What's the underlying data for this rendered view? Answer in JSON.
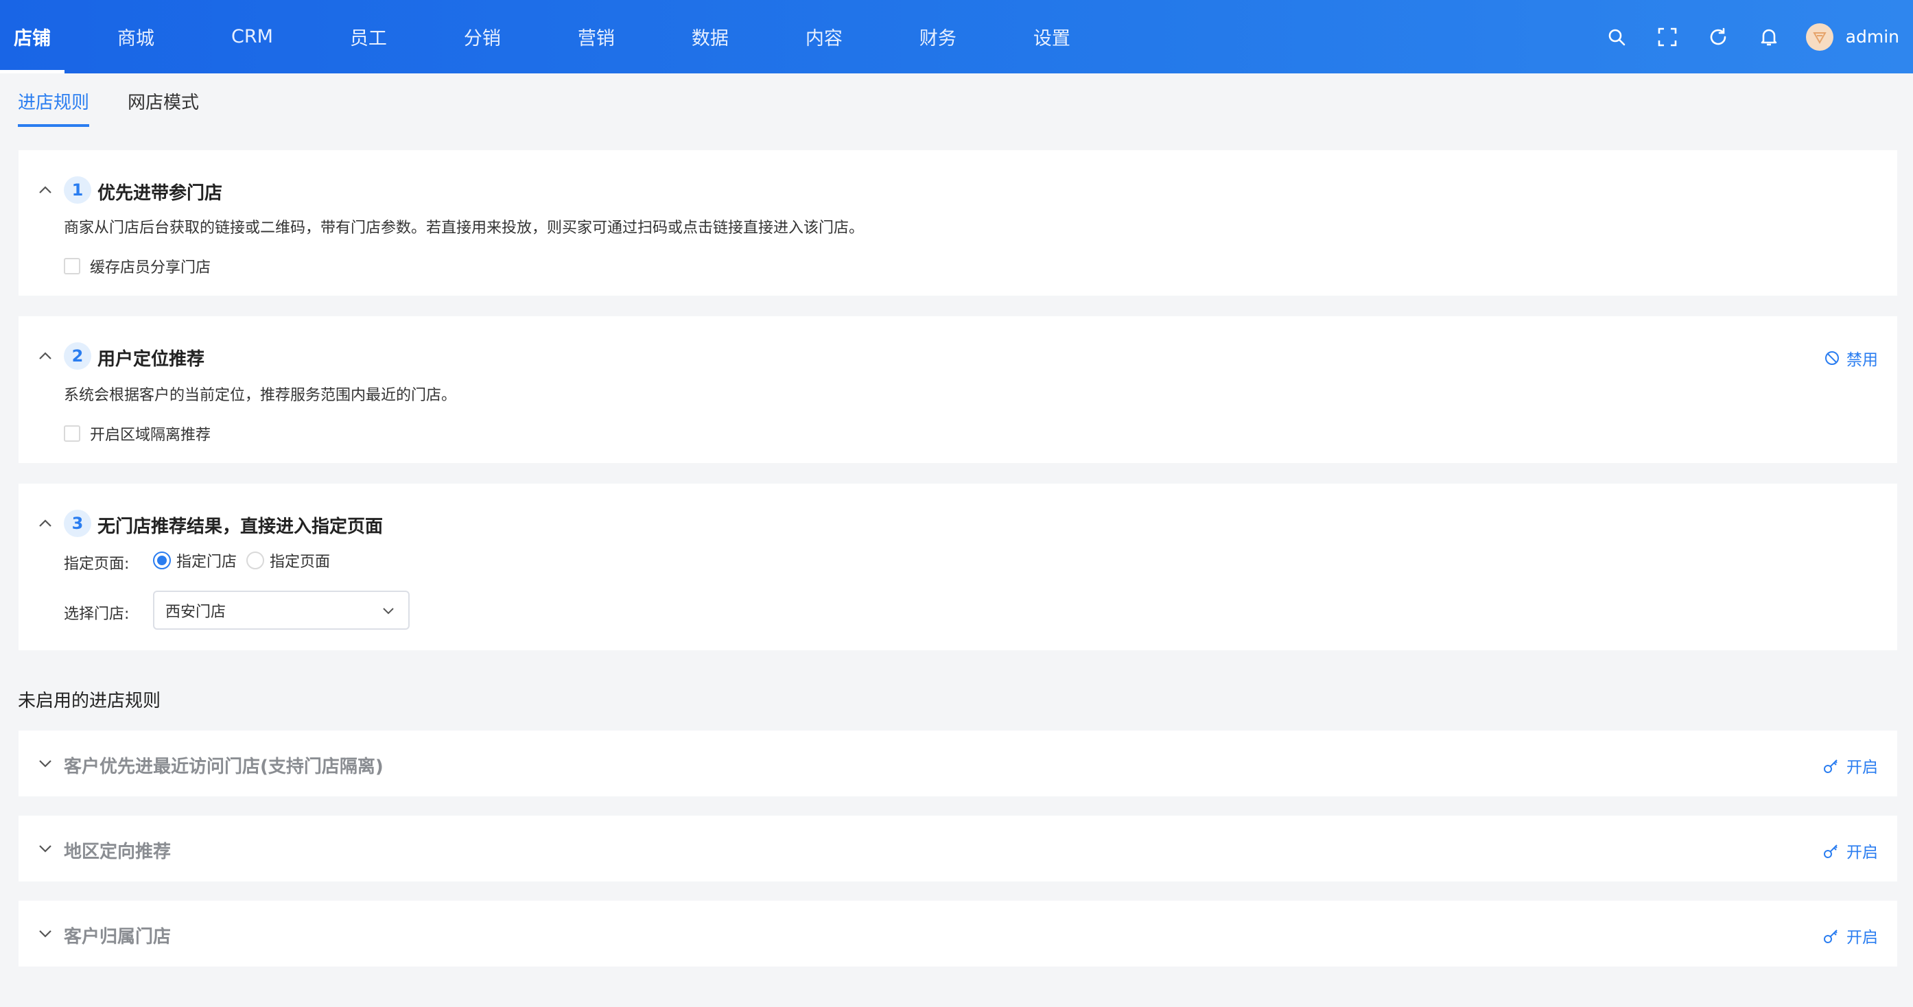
{
  "nav": {
    "items": [
      {
        "label": "店铺"
      },
      {
        "label": "商城"
      },
      {
        "label": "CRM"
      },
      {
        "label": "员工"
      },
      {
        "label": "分销"
      },
      {
        "label": "营销"
      },
      {
        "label": "数据"
      },
      {
        "label": "内容"
      },
      {
        "label": "财务"
      },
      {
        "label": "设置"
      }
    ],
    "active_index": 0,
    "icons": [
      "search-icon",
      "fullscreen-icon",
      "refresh-icon",
      "bell-icon"
    ],
    "username": "admin"
  },
  "subtabs": [
    {
      "label": "进店规则",
      "active": true
    },
    {
      "label": "网店模式",
      "active": false
    }
  ],
  "enabled_rules": [
    {
      "number": "1",
      "title": "优先进带参门店",
      "description": "商家从门店后台获取的链接或二维码，带有门店参数。若直接用来投放，则买家可通过扫码或点击链接直接进入该门店。",
      "checkbox_label": "缓存店员分享门店",
      "checked": false
    },
    {
      "number": "2",
      "title": "用户定位推荐",
      "description": "系统会根据客户的当前定位，推荐服务范围内最近的门店。",
      "checkbox_label": "开启区域隔离推荐",
      "checked": false,
      "action_label": "禁用"
    },
    {
      "number": "3",
      "title": "无门店推荐结果，直接进入指定页面",
      "page_label": "指定页面:",
      "radio_options": [
        {
          "label": "指定门店",
          "checked": true
        },
        {
          "label": "指定页面",
          "checked": false
        }
      ],
      "store_label": "选择门店:",
      "store_value": "西安门店"
    }
  ],
  "disabled_section_title": "未启用的进店规则",
  "disabled_rules": [
    {
      "title": "客户优先进最近访问门店(支持门店隔离)",
      "action_label": "开启"
    },
    {
      "title": "地区定向推荐",
      "action_label": "开启"
    },
    {
      "title": "客户归属门店",
      "action_label": "开启"
    }
  ],
  "colors": {
    "primary": "#2a7df0",
    "topbar_start": "#1965e6",
    "topbar_end": "#2f86ee",
    "background": "#f4f5f7",
    "muted_title": "#8a8d92"
  }
}
